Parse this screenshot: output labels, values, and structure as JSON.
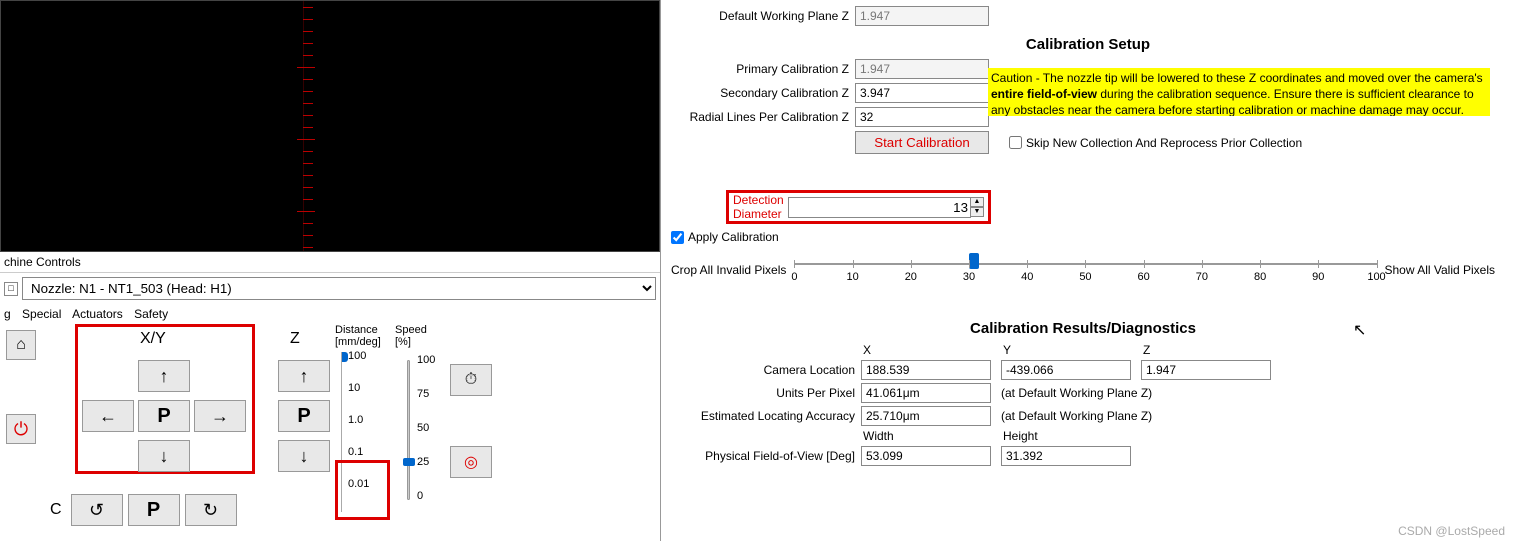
{
  "left": {
    "section_label": "chine Controls",
    "nozzle": "Nozzle: N1 - NT1_503 (Head: H1)",
    "tabs": [
      "g",
      "Special",
      "Actuators",
      "Safety"
    ],
    "xy_label": "X/Y",
    "z_label": "Z",
    "c_label": "C",
    "p_label": "P",
    "distance_header": "Distance",
    "distance_unit": "[mm/deg]",
    "distance_points": [
      "100",
      "10",
      "1.0",
      "0.1",
      "0.01"
    ],
    "speed_header": "Speed",
    "speed_unit": "[%]",
    "speed_points": [
      "100",
      "75",
      "50",
      "25",
      "0"
    ]
  },
  "right": {
    "default_z_label": "Default Working Plane Z",
    "default_z": "1.947",
    "cal_setup_header": "Calibration Setup",
    "primary_z_label": "Primary Calibration Z",
    "primary_z": "1.947",
    "secondary_z_label": "Secondary Calibration Z",
    "secondary_z": "3.947",
    "radial_label": "Radial Lines Per Calibration Z",
    "radial": "32",
    "start_cal": "Start Calibration",
    "skip_label": "Skip New Collection And Reprocess Prior Collection",
    "caution_pre": "Caution - The nozzle tip will be lowered to these Z coordinates and moved over the camera's ",
    "caution_bold": "entire field-of-view",
    "caution_post": " during the calibration sequence. Ensure there is sufficient clearance to any obstacles near the camera before starting calibration or machine damage may occur.",
    "det_label": "Detection Diameter",
    "det_value": "13",
    "apply_label": "Apply Calibration",
    "crop_left": "Crop All Invalid Pixels",
    "crop_right": "Show All Valid Pixels",
    "crop_ticks": [
      "0",
      "10",
      "20",
      "30",
      "40",
      "50",
      "60",
      "70",
      "80",
      "90",
      "100"
    ],
    "results_header": "Calibration Results/Diagnostics",
    "col_x": "X",
    "col_y": "Y",
    "col_z": "Z",
    "cam_loc_label": "Camera Location",
    "cam_x": "188.539",
    "cam_y": "-439.066",
    "cam_z": "1.947",
    "upp_label": "Units Per Pixel",
    "upp": "41.061μm",
    "upp_note": "(at Default Working Plane Z)",
    "acc_label": "Estimated Locating Accuracy",
    "acc": "25.710μm",
    "acc_note": "(at Default Working Plane Z)",
    "col_w": "Width",
    "col_h": "Height",
    "fov_label": "Physical Field-of-View [Deg]",
    "fov_w": "53.099",
    "fov_h": "31.392",
    "watermark": "CSDN @LostSpeed"
  }
}
